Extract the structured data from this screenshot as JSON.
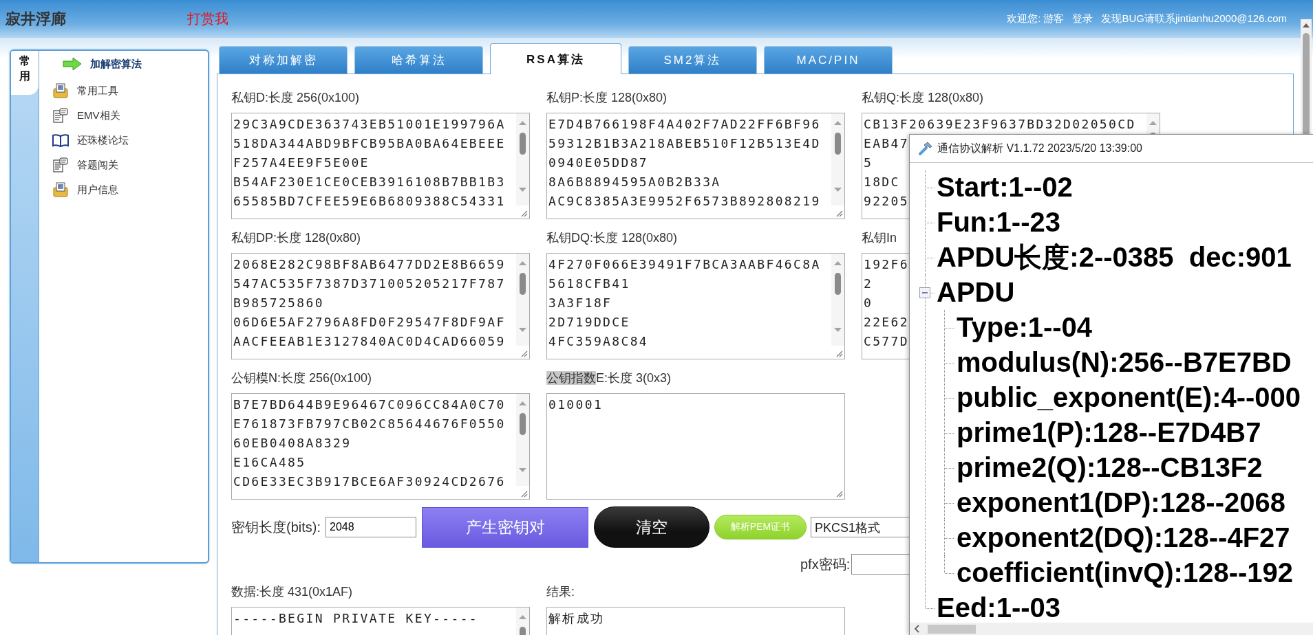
{
  "header": {
    "site_title": "寂井浮廊",
    "reward_link": "打赏我",
    "welcome": "欢迎您: 游客",
    "login_link": "登录",
    "contact": "发现BUG请联系jintianhu2000@126.com"
  },
  "sidebar": {
    "tab": "常用",
    "items": [
      {
        "label": "加解密算法",
        "kind": "arrow",
        "selected": true
      },
      {
        "label": "常用工具",
        "kind": "toolbox",
        "selected": false
      },
      {
        "label": "EMV相关",
        "kind": "document",
        "selected": false
      },
      {
        "label": "还珠楼论坛",
        "kind": "book",
        "selected": false
      },
      {
        "label": "答题闯关",
        "kind": "document",
        "selected": false
      },
      {
        "label": "用户信息",
        "kind": "toolbox",
        "selected": false
      }
    ]
  },
  "tabs": [
    {
      "label": "对称加解密",
      "selected": false
    },
    {
      "label": "哈希算法",
      "selected": false
    },
    {
      "label": "RSA算法",
      "selected": true
    },
    {
      "label": "SM2算法",
      "selected": false
    },
    {
      "label": "MAC/PIN",
      "selected": false
    }
  ],
  "key_fields": [
    {
      "label": "私钥D:长度 256(0x100)",
      "kind": "scrolling",
      "lines": [
        "29C3A9CDE363743EB51001E199796A",
        "518DA344ABD9BFCB95BA0BA64EBEEE",
        "F257A4EE9F5E00E",
        "B54AF230E1CE0CEB3916108B7BB1B3",
        "65585BD7CFEE59E6B6809388C54331"
      ]
    },
    {
      "label": "私钥P:长度 128(0x80)",
      "kind": "scrolling",
      "lines": [
        "E7D4B766198F4A402F7AD22FF6BF96",
        "59312B1B3A218ABEB510F12B513E4D",
        "0940E05DD87",
        "8A6B8894595A0B2B33A",
        "AC9C8385A3E9952F6573B892808219"
      ]
    },
    {
      "label": "私钥Q:长度 128(0x80)",
      "kind": "scrolling",
      "lines": [
        "CB13F20639E23F9637BD32D02050CD",
        "EAB47",
        "5",
        "18DC",
        "92205"
      ]
    },
    {
      "label": "私钥DP:长度 128(0x80)",
      "kind": "scrolling",
      "lines": [
        "2068E282C98BF8AB6477DD2E8B6659",
        "547AC535F7387D371005205217F787",
        "B985725860",
        "06D6E5AF2796A8FD0F29547F8DF9AF",
        "AACFEEAB1E3127840AC0D4CAD66059"
      ]
    },
    {
      "label": "私钥DQ:长度 128(0x80)",
      "kind": "scrolling",
      "lines": [
        "4F270F066E39491F7BCA3AABF46C8A",
        "5618CFB41",
        "3A3F18F",
        "2D719DDCE",
        "4FC359A8C84"
      ]
    },
    {
      "label": "私钥In",
      "kind": "scrolling",
      "lines": [
        "192F6",
        "2",
        "0",
        "22E62",
        "C577D"
      ]
    },
    {
      "label": "公钥模N:长度 256(0x100)",
      "kind": "scrolling",
      "lines": [
        "B7E7BD644B9E96467C096CC84A0C70",
        "E761873FB797CB02C85644676F0550",
        "60EB0408A8329",
        "E16CA485",
        "CD6E33EC3B917BCE6AF30924CD2676"
      ]
    },
    {
      "highlighted": "公钥指数",
      "label": "E:长度 3(0x3)",
      "kind": "plain",
      "lines": [
        "010001"
      ]
    }
  ],
  "key_length": {
    "label": "密钥长度(bits):",
    "value": "2048"
  },
  "buttons": [
    {
      "label": "产生密钥对",
      "kind": "primary"
    },
    {
      "label": "清空",
      "kind": "dark"
    },
    {
      "label": "解析PEM证书",
      "kind": "green"
    }
  ],
  "format_select": {
    "value": "PKCS1格式"
  },
  "pfx": {
    "label": "pfx密码:"
  },
  "io_fields": [
    {
      "label": "数据:长度 431(0x1AF)",
      "kind": "scrolling",
      "lines": [
        "-----BEGIN PRIVATE KEY-----"
      ]
    },
    {
      "label": "结果:",
      "kind": "plain",
      "lines": [
        "解析成功"
      ]
    }
  ],
  "popup": {
    "title": "通信协议解析 V1.1.72 2023/5/20 13:39:00",
    "tree": [
      {
        "text": "Start:1--02"
      },
      {
        "text": "Fun:1--23"
      },
      {
        "text": "APDU长度:2--0385  dec:901"
      },
      {
        "text": "APDU",
        "expanded": true,
        "children": [
          {
            "text": "Type:1--04"
          },
          {
            "text": "modulus(N):256--B7E7BD"
          },
          {
            "text": "public_exponent(E):4--000"
          },
          {
            "text": "prime1(P):128--E7D4B7"
          },
          {
            "text": "prime2(Q):128--CB13F2"
          },
          {
            "text": "exponent1(DP):128--2068"
          },
          {
            "text": "exponent2(DQ):128--4F27"
          },
          {
            "text": "coefficient(invQ):128--192"
          }
        ]
      },
      {
        "text": "Eed:1--03"
      }
    ]
  }
}
